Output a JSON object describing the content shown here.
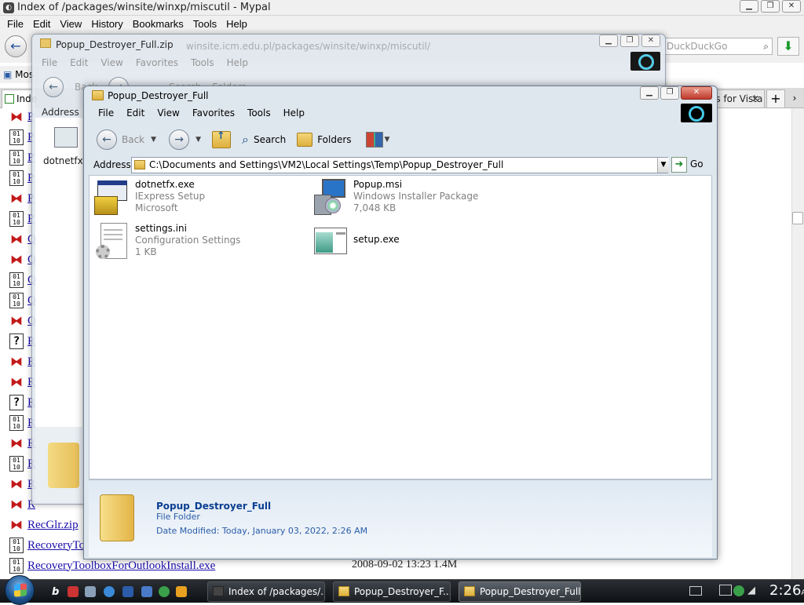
{
  "browser": {
    "title": "Index of /packages/winsite/winxp/miscutil - Mypal",
    "app_icon": "mypal-icon",
    "menu": [
      "File",
      "Edit",
      "View",
      "History",
      "Bookmarks",
      "Tools",
      "Help"
    ],
    "search_placeholder": "DuckDuckGo",
    "bookmarks_label": "Mos",
    "tab_active_label": "Inde",
    "tab_other_label": "idates for Vista St...",
    "listing": [
      {
        "icon": "zip",
        "name": "P"
      },
      {
        "icon": "bin",
        "name": "P"
      },
      {
        "icon": "bin",
        "name": "P"
      },
      {
        "icon": "bin",
        "name": "P"
      },
      {
        "icon": "zip",
        "name": "P"
      },
      {
        "icon": "bin",
        "name": "P"
      },
      {
        "icon": "zip",
        "name": "Q"
      },
      {
        "icon": "zip",
        "name": "Q"
      },
      {
        "icon": "bin",
        "name": "Q"
      },
      {
        "icon": "bin",
        "name": "Q"
      },
      {
        "icon": "zip",
        "name": "Q"
      },
      {
        "icon": "q",
        "name": "R"
      },
      {
        "icon": "zip",
        "name": "R"
      },
      {
        "icon": "zip",
        "name": "R"
      },
      {
        "icon": "q",
        "name": "R"
      },
      {
        "icon": "bin",
        "name": "R"
      },
      {
        "icon": "zip",
        "name": "R"
      },
      {
        "icon": "bin",
        "name": "R"
      },
      {
        "icon": "zip",
        "name": "R"
      },
      {
        "icon": "zip",
        "name": "R"
      },
      {
        "icon": "zip",
        "name": "RecGlr.zip"
      },
      {
        "icon": "bin",
        "name": "RecoveryToo"
      },
      {
        "icon": "bin",
        "name": "RecoveryToolboxForOutlookInstall.exe"
      }
    ],
    "last_row_meta": "2008-09-02 13:23  1.4M"
  },
  "zip_window": {
    "title": "Popup_Destroyer_Full.zip",
    "url_ghost": "winsite.icm.edu.pl/packages/winsite/winxp/miscutil/",
    "menu": [
      "File",
      "Edit",
      "View",
      "Favorites",
      "Tools",
      "Help"
    ],
    "toolbar": {
      "back": "Back",
      "search": "Search",
      "folders": "Folders"
    },
    "address_label": "Address",
    "item_label": "dotnetfx.ex"
  },
  "explorer": {
    "title": "Popup_Destroyer_Full",
    "menu": [
      "File",
      "Edit",
      "View",
      "Favorites",
      "Tools",
      "Help"
    ],
    "toolbar": {
      "back": "Back",
      "search": "Search",
      "folders": "Folders"
    },
    "address_label": "Address",
    "address_value": "C:\\Documents and Settings\\VM2\\Local Settings\\Temp\\Popup_Destroyer_Full",
    "go_label": "Go",
    "files": [
      {
        "name": "dotnetfx.exe",
        "line2": "IExpress Setup",
        "line3": "Microsoft",
        "icon": "installer-box-icon"
      },
      {
        "name": "Popup.msi",
        "line2": "Windows Installer Package",
        "line3": "7,048 KB",
        "icon": "msi-package-icon"
      },
      {
        "name": "settings.ini",
        "line2": "Configuration Settings",
        "line3": "1 KB",
        "icon": "config-file-icon"
      },
      {
        "name": "setup.exe",
        "line2": "",
        "line3": "",
        "icon": "window-app-icon"
      }
    ],
    "details": {
      "name": "Popup_Destroyer_Full",
      "type": "File Folder",
      "modified": "Date Modified: Today, January 03, 2022, 2:26 AM"
    }
  },
  "taskbar": {
    "buttons": [
      "Index of /packages/...",
      "Popup_Destroyer_F...",
      "Popup_Destroyer_Full"
    ],
    "clock_time": "2:26",
    "clock_ampm": "AM"
  }
}
